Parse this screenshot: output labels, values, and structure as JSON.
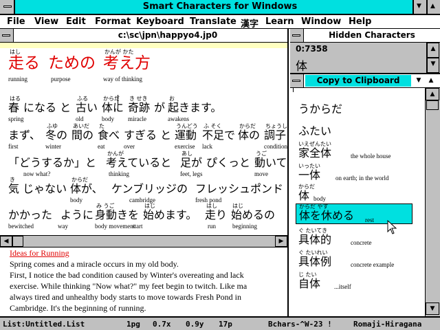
{
  "window": {
    "title": "Smart Characters for Windows"
  },
  "menu": [
    "File",
    "View",
    "Edit",
    "Format",
    "Keyboard",
    "Translate",
    "漢字",
    "Learn",
    "Window",
    "Help"
  ],
  "document": {
    "path": "c:\\sc\\jpn\\happyo4.jp0"
  },
  "title_line": [
    {
      "ruby": "はし",
      "jp": "走る",
      "en": "running"
    },
    {
      "ruby": "",
      "jp": "ための",
      "en": "purpose"
    },
    {
      "ruby": "かんが かた",
      "jp": "考え方",
      "en": "way of thinking"
    }
  ],
  "lines": [
    [
      {
        "ruby": "はる",
        "jp": "春",
        "en": "spring"
      },
      {
        "ruby": "",
        "jp": "になる と",
        "en": ""
      },
      {
        "ruby": "ふる",
        "jp": "古い",
        "en": "old"
      },
      {
        "ruby": "からだ",
        "jp": "体に",
        "en": "body"
      },
      {
        "ruby": "き せき",
        "jp": "奇跡",
        "en": "miracle"
      },
      {
        "ruby": "",
        "jp": "が",
        "en": ""
      },
      {
        "ruby": "お",
        "jp": "起きます。",
        "en": "awakens"
      }
    ],
    [
      {
        "ruby": "",
        "jp": "まず、",
        "en": "first"
      },
      {
        "ruby": "ふゆ",
        "jp": "冬の",
        "en": "winter"
      },
      {
        "ruby": "あいだ",
        "jp": "間の",
        "en": ""
      },
      {
        "ruby": "た",
        "jp": "食べ",
        "en": "eat"
      },
      {
        "ruby": "",
        "jp": "すぎる と",
        "en": "over"
      },
      {
        "ruby": "うんどう",
        "jp": "運動",
        "en": "exercise"
      },
      {
        "ruby": "ふ そく",
        "jp": "不足で",
        "en": "lack"
      },
      {
        "ruby": "からだ",
        "jp": "体の",
        "en": ""
      },
      {
        "ruby": "ちょうし",
        "jp": "調子",
        "en": "condition"
      }
    ],
    [
      {
        "ruby": "",
        "jp": "「どうするか」と",
        "en": "now what?"
      },
      {
        "ruby": "かんが",
        "jp": "考えていると",
        "en": "thinking"
      },
      {
        "ruby": "あし",
        "jp": "足が",
        "en": "feet, legs"
      },
      {
        "ruby": "",
        "jp": "ぴくっと",
        "en": ""
      },
      {
        "ruby": "うご",
        "jp": "動いて",
        "en": "move"
      }
    ],
    [
      {
        "ruby": "き",
        "jp": "気 じゃない",
        "en": ""
      },
      {
        "ruby": "からだ",
        "jp": "体が、",
        "en": "body"
      },
      {
        "ruby": "",
        "jp": "ケンブリッジの",
        "en": "cambridge"
      },
      {
        "ruby": "",
        "jp": "フレッシュポンド",
        "en": "fresh pond"
      }
    ],
    [
      {
        "ruby": "",
        "jp": "かかった",
        "en": "bewitched"
      },
      {
        "ruby": "",
        "jp": "ように",
        "en": "way"
      },
      {
        "ruby": "み うご",
        "jp": "身動きを",
        "en": "body movement"
      },
      {
        "ruby": "はじ",
        "jp": "始めます。",
        "en": "start"
      },
      {
        "ruby": "はし",
        "jp": "走り",
        "en": "run"
      },
      {
        "ruby": "はじ",
        "jp": "始めるの",
        "en": "beginning"
      }
    ]
  ],
  "english": {
    "heading": "Ideas for Running",
    "lines": [
      "Spring comes and a miracle occurs in my old body.",
      "First, I notice the bad condition caused by Winter's overeating and lack",
      "exercise. While thinking \"Now what?\" my feet begin to twitch. Like ma",
      "always tired and unhealthy body starts to move towards Fresh Pond in",
      "Cambridge. It's the beginning of running."
    ]
  },
  "hidden": {
    "title": "Hidden Characters",
    "code": "0:7358",
    "char": "体"
  },
  "clipboard": {
    "button": "Copy to Clipboard",
    "items": [
      {
        "ruby": "",
        "jp": "うからだ",
        "gloss": ""
      },
      {
        "ruby": "",
        "jp": "ふたい",
        "gloss": ""
      },
      {
        "ruby": "いえぜんたい",
        "jp": "家全体",
        "gloss": "the whole house"
      },
      {
        "ruby": "いったい",
        "jp": "一体",
        "gloss": "on earth; in the world"
      },
      {
        "ruby": "からだ",
        "jp": "体",
        "gloss": "body"
      },
      {
        "ruby": "からだ やす",
        "jp": "体を休める",
        "gloss": "rest"
      },
      {
        "ruby": "ぐ たいてき",
        "jp": "具体的",
        "gloss": "concrete"
      },
      {
        "ruby": "ぐ たいれい",
        "jp": "具体例",
        "gloss": "concrete example"
      },
      {
        "ruby": "じ たい",
        "jp": "自体",
        "gloss": "...itself"
      }
    ]
  },
  "status": {
    "list": "List:Untitled.List",
    "page": "1pg",
    "x": "0.7x",
    "y": "0.9y",
    "pt": "17p",
    "chars": "Bchars-^W-23 !",
    "mode": "Romaji-Hiragana"
  }
}
